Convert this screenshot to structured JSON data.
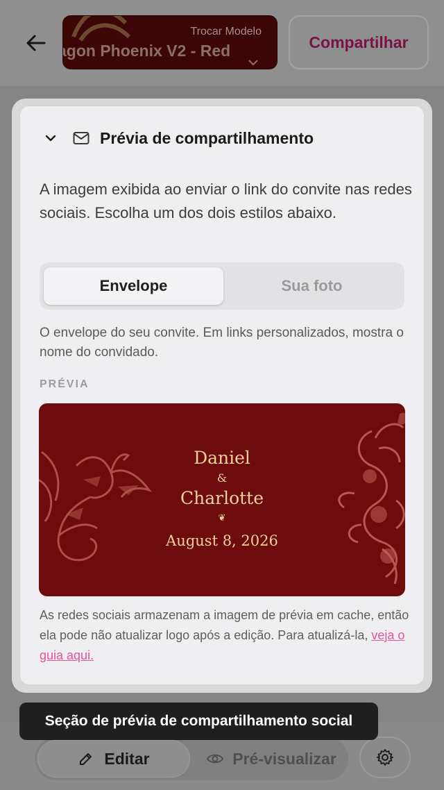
{
  "header": {
    "template_caption": "Trocar Modelo",
    "template_name": "agon Phoenix V2 - Red",
    "share_label": "Compartilhar"
  },
  "panel": {
    "title": "Prévia de compartilhamento",
    "description": "A imagem exibida ao enviar o link do convite nas redes sociais. Escolha um dos dois estilos abaixo.",
    "toggle": {
      "options": [
        "Envelope",
        "Sua foto"
      ],
      "selected": "Envelope"
    },
    "envelope_help": "O envelope do seu convite. Em links personalizados, mostra o nome do convidado.",
    "preview_label": "PRÉVIA",
    "preview_card": {
      "name1": "Daniel",
      "amp": "&",
      "name2": "Charlotte",
      "flourish": "❦",
      "date": "August 8, 2026"
    },
    "cache_note": "As redes sociais armazenam a imagem de prévia em cache, então ela pode não atualizar logo após a edição. Para atualizá-la, ",
    "guide_link": "veja o guia aqui."
  },
  "tooltip": "Seção de prévia de compartilhamento social",
  "bottom_bar": {
    "edit_label": "Editar",
    "preview_label": "Pré-visualizar"
  },
  "colors": {
    "card_bg": "#6e0b0d",
    "card_text": "#f2d29a",
    "link": "#e0559c",
    "share_text": "#7a1343"
  },
  "icons": [
    "arrow-left-icon",
    "chevron-down-icon",
    "mail-icon",
    "pencil-icon",
    "eye-icon",
    "gear-icon",
    "phoenix-ornament",
    "dragon-ornament"
  ]
}
